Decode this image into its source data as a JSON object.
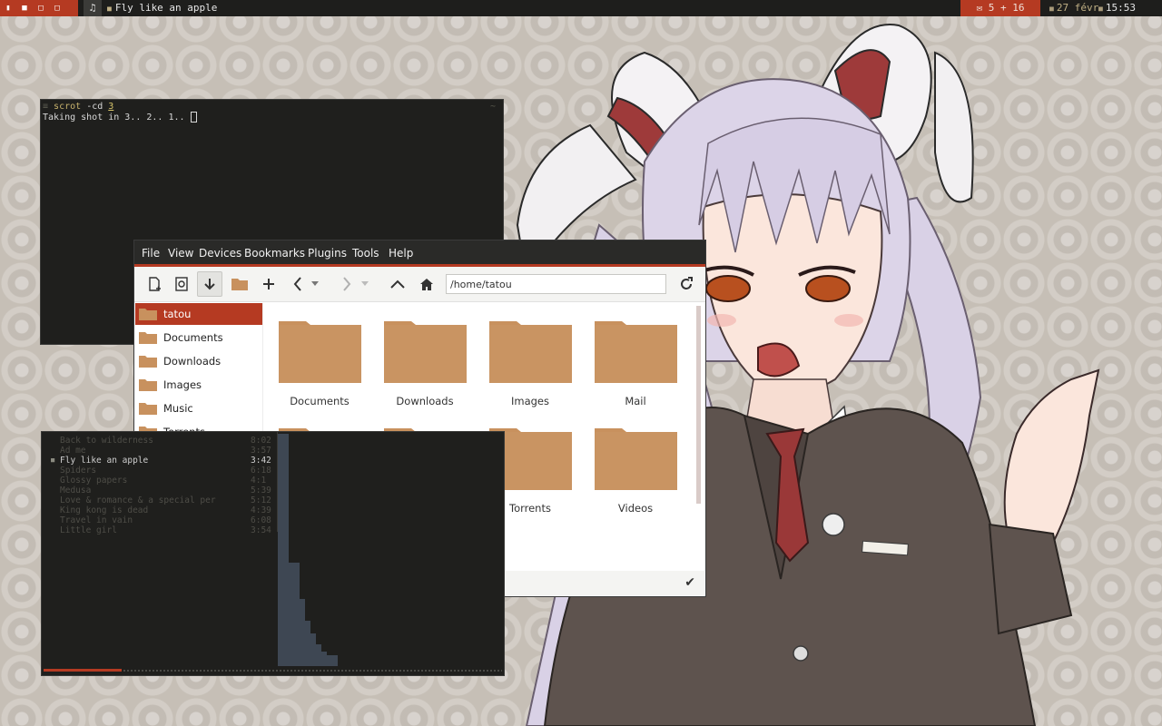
{
  "topbar": {
    "workspace_icons": [
      "▮",
      "■",
      "□",
      "□"
    ],
    "music_icon": "♫",
    "window_title": "Fly like an apple",
    "mail_label": "✉ 5 + 16",
    "date": "27 févr.",
    "time": "15:53"
  },
  "terminal": {
    "command": "scrot",
    "args": "-cd",
    "delay": "3",
    "output": "Taking shot in 3.. 2.. 1.. ",
    "cwd_marker": "~"
  },
  "player": {
    "tracks": [
      {
        "title": "Back to wilderness",
        "duration": "8:02"
      },
      {
        "title": "Ad me",
        "duration": "3:57"
      },
      {
        "title": "Fly like an apple",
        "duration": "3:42"
      },
      {
        "title": "Spiders",
        "duration": "6:18"
      },
      {
        "title": "Glossy papers",
        "duration": "4:1"
      },
      {
        "title": "Medusa",
        "duration": "5:39"
      },
      {
        "title": "Love & romance & a special per",
        "duration": "5:12"
      },
      {
        "title": "King kong is dead",
        "duration": "4:39"
      },
      {
        "title": "Travel in vain",
        "duration": "6:08"
      },
      {
        "title": "Little girl",
        "duration": "3:54"
      }
    ],
    "active_index": 2,
    "progress": 0.17
  },
  "file_manager": {
    "menu": [
      "File",
      "View",
      "Devices",
      "Bookmarks",
      "Plugins",
      "Tools",
      "Help"
    ],
    "address": "/home/tatou",
    "sidebar": [
      "tatou",
      "Documents",
      "Downloads",
      "Images",
      "Music",
      "Torrents"
    ],
    "sidebar_selected": 0,
    "folders": [
      "Documents",
      "Downloads",
      "Images",
      "Mail",
      "",
      "",
      "Torrents",
      "Videos"
    ],
    "accent_color": "#b53a22",
    "folder_color": "#c8915e"
  }
}
